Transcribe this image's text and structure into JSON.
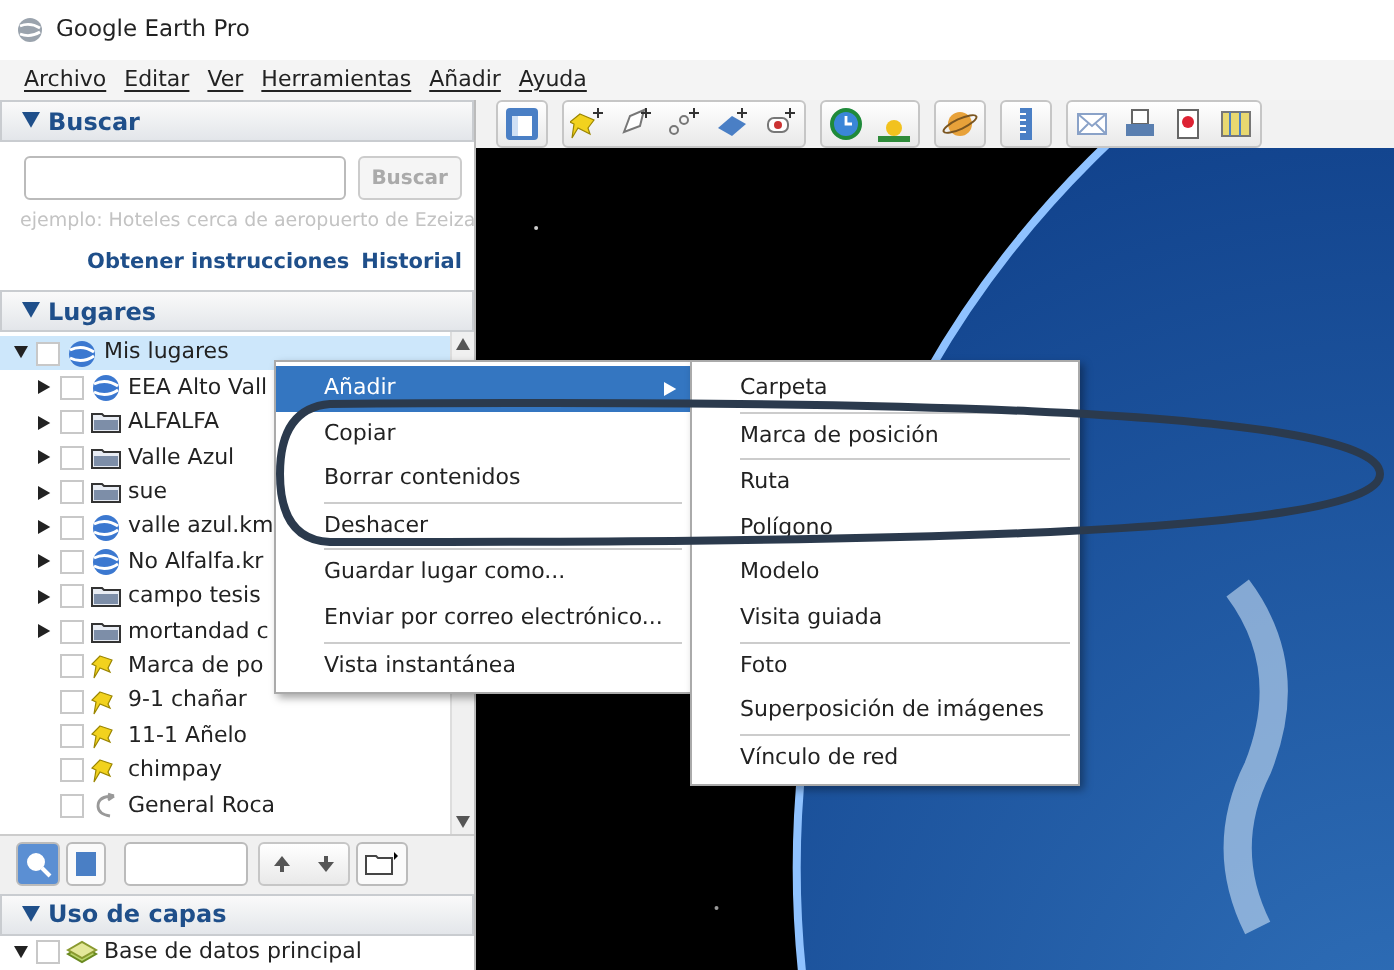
{
  "window": {
    "title": "Google Earth Pro"
  },
  "menu_bar": [
    "Archivo",
    "Editar",
    "Ver",
    "Herramientas",
    "Añadir",
    "Ayuda"
  ],
  "search_panel": {
    "title": "Buscar",
    "expanded": true,
    "button": "Buscar",
    "placeholder": "ejemplo: Hoteles cerca de aeropuerto de Ezeiza",
    "links": [
      "Obtener instrucciones",
      "Historial"
    ]
  },
  "places_panel": {
    "title": "Lugares",
    "expanded": true,
    "tree": [
      {
        "label": "Mis lugares",
        "kind": "globe",
        "checked": false,
        "expanded": true,
        "selected": true,
        "children": [
          {
            "label": "EEA Alto Vall",
            "kind": "globe",
            "checked": false,
            "expanded": false,
            "selected": false
          },
          {
            "label": "ALFALFA",
            "kind": "folder",
            "checked": false,
            "expanded": false,
            "selected": false
          },
          {
            "label": "Valle Azul",
            "kind": "folder",
            "checked": false,
            "expanded": false,
            "selected": false
          },
          {
            "label": "sue",
            "kind": "folder",
            "checked": false,
            "expanded": false,
            "selected": false
          },
          {
            "label": "valle azul.km",
            "kind": "globe",
            "checked": false,
            "expanded": false,
            "selected": false
          },
          {
            "label": "No Alfalfa.kr",
            "kind": "globe",
            "checked": false,
            "expanded": false,
            "selected": false
          },
          {
            "label": "campo tesis",
            "kind": "folder",
            "checked": false,
            "expanded": false,
            "selected": false
          },
          {
            "label": "mortandad c",
            "kind": "folder",
            "checked": false,
            "expanded": false,
            "selected": false
          },
          {
            "label": "Marca de po",
            "kind": "pin",
            "checked": false,
            "selected": false
          },
          {
            "label": "9-1 chañar",
            "kind": "pin",
            "checked": false,
            "selected": false
          },
          {
            "label": "11-1 Añelo",
            "kind": "pin",
            "checked": false,
            "selected": false
          },
          {
            "label": "chimpay",
            "kind": "pin",
            "checked": false,
            "selected": false
          },
          {
            "label": "General Roca",
            "kind": "path",
            "checked": false,
            "selected": false
          }
        ]
      }
    ]
  },
  "layers_panel": {
    "title": "Uso de capas",
    "expanded": true,
    "items": [
      {
        "label": "Base de datos principal",
        "checked": false,
        "expanded": true
      }
    ]
  },
  "context_menu": [
    {
      "label": "Añadir",
      "selected": true,
      "submenu": true,
      "separator_after": false
    },
    {
      "label": "Copiar",
      "selected": false,
      "submenu": false,
      "separator_after": false
    },
    {
      "label": "Borrar contenidos",
      "selected": false,
      "submenu": false,
      "separator_after": true
    },
    {
      "label": "Deshacer",
      "selected": false,
      "submenu": false,
      "separator_after": true
    },
    {
      "label": "Guardar lugar como...",
      "selected": false,
      "submenu": false,
      "separator_after": false
    },
    {
      "label": "Enviar por correo electrónico...",
      "selected": false,
      "submenu": false,
      "separator_after": true
    },
    {
      "label": "Vista instantánea",
      "selected": false,
      "submenu": false,
      "separator_after": false
    }
  ],
  "submenu": [
    {
      "label": "Carpeta",
      "separator_after": true
    },
    {
      "label": "Marca de posición",
      "separator_after": true
    },
    {
      "label": "Ruta",
      "separator_after": false
    },
    {
      "label": "Polígono",
      "separator_after": false
    },
    {
      "label": "Modelo",
      "separator_after": false
    },
    {
      "label": "Visita guiada",
      "separator_after": true
    },
    {
      "label": "Foto",
      "separator_after": false
    },
    {
      "label": "Superposición de imágenes",
      "separator_after": true
    },
    {
      "label": "Vínculo de red",
      "separator_after": false
    }
  ]
}
